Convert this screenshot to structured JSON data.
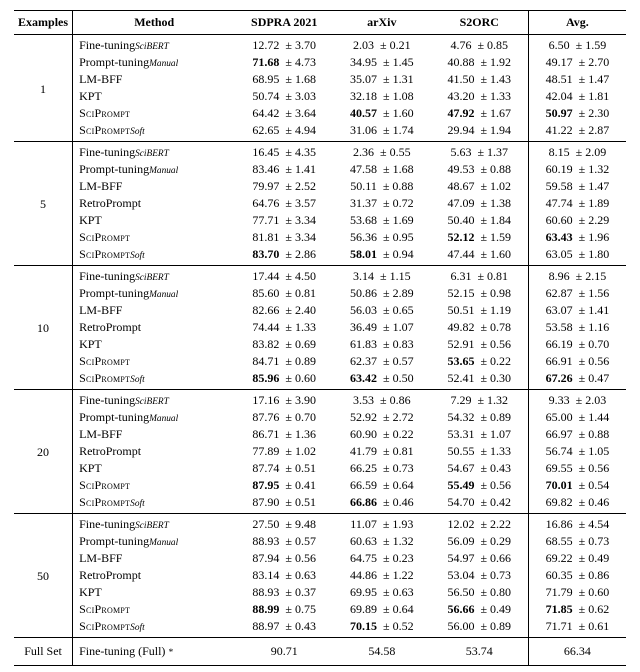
{
  "chart_data": {
    "type": "table",
    "title": "",
    "columns": [
      "Examples",
      "Method",
      "SDPRA 2021",
      "arXiv",
      "S2ORC",
      "Avg."
    ],
    "groups": [
      {
        "examples": "1",
        "rows": [
          {
            "method_html": "Fine-tuning<span class='sub'>SciBERT</span>",
            "vals": [
              [
                "12.72",
                "3.70",
                false
              ],
              [
                "2.03",
                "0.21",
                false
              ],
              [
                "4.76",
                "0.85",
                false
              ],
              [
                "6.50",
                "1.59",
                false
              ]
            ]
          },
          {
            "method_html": "Prompt-tuning<span class='sub'>Manual</span>",
            "vals": [
              [
                "71.68",
                "4.73",
                true
              ],
              [
                "34.95",
                "1.45",
                false
              ],
              [
                "40.88",
                "1.92",
                false
              ],
              [
                "49.17",
                "2.70",
                false
              ]
            ]
          },
          {
            "method_html": "LM-BFF",
            "vals": [
              [
                "68.95",
                "1.68",
                false
              ],
              [
                "35.07",
                "1.31",
                false
              ],
              [
                "41.50",
                "1.43",
                false
              ],
              [
                "48.51",
                "1.47",
                false
              ]
            ]
          },
          {
            "method_html": "KPT",
            "vals": [
              [
                "50.74",
                "3.03",
                false
              ],
              [
                "32.18",
                "1.08",
                false
              ],
              [
                "43.20",
                "1.33",
                false
              ],
              [
                "42.04",
                "1.81",
                false
              ]
            ]
          },
          {
            "method_html": "<span class='sc'>SciPrompt</span>",
            "vals": [
              [
                "64.42",
                "3.64",
                false
              ],
              [
                "40.57",
                "1.60",
                true
              ],
              [
                "47.92",
                "1.67",
                true
              ],
              [
                "50.97",
                "2.30",
                true
              ]
            ]
          },
          {
            "method_html": "<span class='sc'>SciPrompt</span><span class='sub'>Soft</span>",
            "vals": [
              [
                "62.65",
                "4.94",
                false
              ],
              [
                "31.06",
                "1.74",
                false
              ],
              [
                "29.94",
                "1.94",
                false
              ],
              [
                "41.22",
                "2.87",
                false
              ]
            ]
          }
        ]
      },
      {
        "examples": "5",
        "rows": [
          {
            "method_html": "Fine-tuning<span class='sub'>SciBERT</span>",
            "vals": [
              [
                "16.45",
                "4.35",
                false
              ],
              [
                "2.36",
                "0.55",
                false
              ],
              [
                "5.63",
                "1.37",
                false
              ],
              [
                "8.15",
                "2.09",
                false
              ]
            ]
          },
          {
            "method_html": "Prompt-tuning<span class='sub'>Manual</span>",
            "vals": [
              [
                "83.46",
                "1.41",
                false
              ],
              [
                "47.58",
                "1.68",
                false
              ],
              [
                "49.53",
                "0.88",
                false
              ],
              [
                "60.19",
                "1.32",
                false
              ]
            ]
          },
          {
            "method_html": "LM-BFF",
            "vals": [
              [
                "79.97",
                "2.52",
                false
              ],
              [
                "50.11",
                "0.88",
                false
              ],
              [
                "48.67",
                "1.02",
                false
              ],
              [
                "59.58",
                "1.47",
                false
              ]
            ]
          },
          {
            "method_html": "RetroPrompt",
            "vals": [
              [
                "64.76",
                "3.57",
                false
              ],
              [
                "31.37",
                "0.72",
                false
              ],
              [
                "47.09",
                "1.38",
                false
              ],
              [
                "47.74",
                "1.89",
                false
              ]
            ]
          },
          {
            "method_html": "KPT",
            "vals": [
              [
                "77.71",
                "3.34",
                false
              ],
              [
                "53.68",
                "1.69",
                false
              ],
              [
                "50.40",
                "1.84",
                false
              ],
              [
                "60.60",
                "2.29",
                false
              ]
            ]
          },
          {
            "method_html": "<span class='sc'>SciPrompt</span>",
            "vals": [
              [
                "81.81",
                "3.34",
                false
              ],
              [
                "56.36",
                "0.95",
                false
              ],
              [
                "52.12",
                "1.59",
                true
              ],
              [
                "63.43",
                "1.96",
                true
              ]
            ]
          },
          {
            "method_html": "<span class='sc'>SciPrompt</span><span class='sub'>Soft</span>",
            "vals": [
              [
                "83.70",
                "2.86",
                true
              ],
              [
                "58.01",
                "0.94",
                true
              ],
              [
                "47.44",
                "1.60",
                false
              ],
              [
                "63.05",
                "1.80",
                false
              ]
            ]
          }
        ]
      },
      {
        "examples": "10",
        "rows": [
          {
            "method_html": "Fine-tuning<span class='sub'>SciBERT</span>",
            "vals": [
              [
                "17.44",
                "4.50",
                false
              ],
              [
                "3.14",
                "1.15",
                false
              ],
              [
                "6.31",
                "0.81",
                false
              ],
              [
                "8.96",
                "2.15",
                false
              ]
            ]
          },
          {
            "method_html": "Prompt-tuning<span class='sub'>Manual</span>",
            "vals": [
              [
                "85.60",
                "0.81",
                false
              ],
              [
                "50.86",
                "2.89",
                false
              ],
              [
                "52.15",
                "0.98",
                false
              ],
              [
                "62.87",
                "1.56",
                false
              ]
            ]
          },
          {
            "method_html": "LM-BFF",
            "vals": [
              [
                "82.66",
                "2.40",
                false
              ],
              [
                "56.03",
                "0.65",
                false
              ],
              [
                "50.51",
                "1.19",
                false
              ],
              [
                "63.07",
                "1.41",
                false
              ]
            ]
          },
          {
            "method_html": "RetroPrompt",
            "vals": [
              [
                "74.44",
                "1.33",
                false
              ],
              [
                "36.49",
                "1.07",
                false
              ],
              [
                "49.82",
                "0.78",
                false
              ],
              [
                "53.58",
                "1.16",
                false
              ]
            ]
          },
          {
            "method_html": "KPT",
            "vals": [
              [
                "83.82",
                "0.69",
                false
              ],
              [
                "61.83",
                "0.83",
                false
              ],
              [
                "52.91",
                "0.56",
                false
              ],
              [
                "66.19",
                "0.70",
                false
              ]
            ]
          },
          {
            "method_html": "<span class='sc'>SciPrompt</span>",
            "vals": [
              [
                "84.71",
                "0.89",
                false
              ],
              [
                "62.37",
                "0.57",
                false
              ],
              [
                "53.65",
                "0.22",
                true
              ],
              [
                "66.91",
                "0.56",
                false
              ]
            ]
          },
          {
            "method_html": "<span class='sc'>SciPrompt</span><span class='sub'>Soft</span>",
            "vals": [
              [
                "85.96",
                "0.60",
                true
              ],
              [
                "63.42",
                "0.50",
                true
              ],
              [
                "52.41",
                "0.30",
                false
              ],
              [
                "67.26",
                "0.47",
                true
              ]
            ]
          }
        ]
      },
      {
        "examples": "20",
        "rows": [
          {
            "method_html": "Fine-tuning<span class='sub'>SciBERT</span>",
            "vals": [
              [
                "17.16",
                "3.90",
                false
              ],
              [
                "3.53",
                "0.86",
                false
              ],
              [
                "7.29",
                "1.32",
                false
              ],
              [
                "9.33",
                "2.03",
                false
              ]
            ]
          },
          {
            "method_html": "Prompt-tuning<span class='sub'>Manual</span>",
            "vals": [
              [
                "87.76",
                "0.70",
                false
              ],
              [
                "52.92",
                "2.72",
                false
              ],
              [
                "54.32",
                "0.89",
                false
              ],
              [
                "65.00",
                "1.44",
                false
              ]
            ]
          },
          {
            "method_html": "LM-BFF",
            "vals": [
              [
                "86.71",
                "1.36",
                false
              ],
              [
                "60.90",
                "0.22",
                false
              ],
              [
                "53.31",
                "1.07",
                false
              ],
              [
                "66.97",
                "0.88",
                false
              ]
            ]
          },
          {
            "method_html": "RetroPrompt",
            "vals": [
              [
                "77.89",
                "1.02",
                false
              ],
              [
                "41.79",
                "0.81",
                false
              ],
              [
                "50.55",
                "1.33",
                false
              ],
              [
                "56.74",
                "1.05",
                false
              ]
            ]
          },
          {
            "method_html": "KPT",
            "vals": [
              [
                "87.74",
                "0.51",
                false
              ],
              [
                "66.25",
                "0.73",
                false
              ],
              [
                "54.67",
                "0.43",
                false
              ],
              [
                "69.55",
                "0.56",
                false
              ]
            ]
          },
          {
            "method_html": "<span class='sc'>SciPrompt</span>",
            "vals": [
              [
                "87.95",
                "0.41",
                true
              ],
              [
                "66.59",
                "0.64",
                false
              ],
              [
                "55.49",
                "0.56",
                true
              ],
              [
                "70.01",
                "0.54",
                true
              ]
            ]
          },
          {
            "method_html": "<span class='sc'>SciPrompt</span><span class='sub'>Soft</span>",
            "vals": [
              [
                "87.90",
                "0.51",
                false
              ],
              [
                "66.86",
                "0.46",
                true
              ],
              [
                "54.70",
                "0.42",
                false
              ],
              [
                "69.82",
                "0.46",
                false
              ]
            ]
          }
        ]
      },
      {
        "examples": "50",
        "rows": [
          {
            "method_html": "Fine-tuning<span class='sub'>SciBERT</span>",
            "vals": [
              [
                "27.50",
                "9.48",
                false
              ],
              [
                "11.07",
                "1.93",
                false
              ],
              [
                "12.02",
                "2.22",
                false
              ],
              [
                "16.86",
                "4.54",
                false
              ]
            ]
          },
          {
            "method_html": "Prompt-tuning<span class='sub'>Manual</span>",
            "vals": [
              [
                "88.93",
                "0.57",
                false
              ],
              [
                "60.63",
                "1.32",
                false
              ],
              [
                "56.09",
                "0.29",
                false
              ],
              [
                "68.55",
                "0.73",
                false
              ]
            ]
          },
          {
            "method_html": "LM-BFF",
            "vals": [
              [
                "87.94",
                "0.56",
                false
              ],
              [
                "64.75",
                "0.23",
                false
              ],
              [
                "54.97",
                "0.66",
                false
              ],
              [
                "69.22",
                "0.49",
                false
              ]
            ]
          },
          {
            "method_html": "RetroPrompt",
            "vals": [
              [
                "83.14",
                "0.63",
                false
              ],
              [
                "44.86",
                "1.22",
                false
              ],
              [
                "53.04",
                "0.73",
                false
              ],
              [
                "60.35",
                "0.86",
                false
              ]
            ]
          },
          {
            "method_html": "KPT",
            "vals": [
              [
                "88.93",
                "0.37",
                false
              ],
              [
                "69.95",
                "0.63",
                false
              ],
              [
                "56.50",
                "0.80",
                false
              ],
              [
                "71.79",
                "0.60",
                false
              ]
            ]
          },
          {
            "method_html": "<span class='sc'>SciPrompt</span>",
            "vals": [
              [
                "88.99",
                "0.75",
                true
              ],
              [
                "69.89",
                "0.64",
                false
              ],
              [
                "56.66",
                "0.49",
                true
              ],
              [
                "71.85",
                "0.62",
                true
              ]
            ]
          },
          {
            "method_html": "<span class='sc'>SciPrompt</span><span class='sub'>Soft</span>",
            "vals": [
              [
                "88.97",
                "0.43",
                false
              ],
              [
                "70.15",
                "0.52",
                true
              ],
              [
                "56.00",
                "0.89",
                false
              ],
              [
                "71.71",
                "0.61",
                false
              ]
            ]
          }
        ]
      }
    ],
    "full": {
      "examples": "Full Set",
      "method_html": "Fine-tuning (Full) <span class='star'>*</span>",
      "vals": [
        "90.71",
        "54.58",
        "53.74",
        "66.34"
      ]
    }
  },
  "headers": {
    "examples": "Examples",
    "method": "Method",
    "sdpra": "SDPRA 2021",
    "arxiv": "arXiv",
    "s2orc": "S2ORC",
    "avg": "Avg."
  }
}
